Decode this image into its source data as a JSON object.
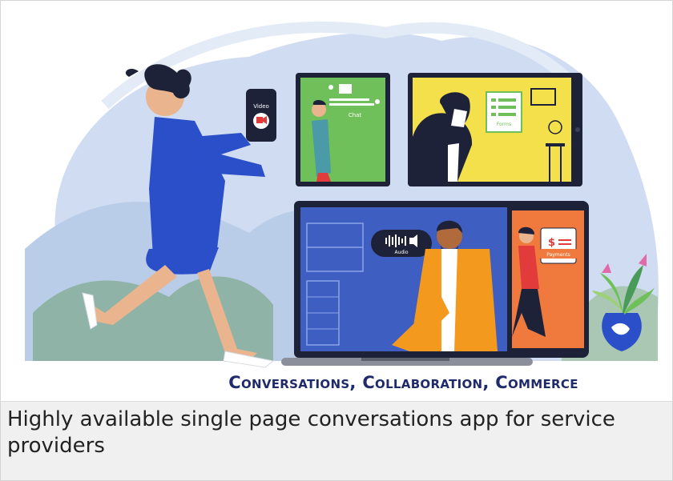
{
  "screens": {
    "video_label": "Video",
    "chat_label": "Chat",
    "forms_label": "Forms",
    "audio_label": "Audio",
    "payments_label": "Payments",
    "payments_amount_symbol": "$"
  },
  "hero": {
    "tagline": "Conversations, Collaboration, Commerce"
  },
  "card": {
    "description": "Highly available single page conversations app for service providers"
  },
  "colors": {
    "navy": "#1f2a6b",
    "green_screen": "#6fbf5a",
    "yellow_screen": "#f3e04a",
    "blue_screen": "#3f5ec2",
    "orange_screen": "#f07a3e",
    "sky": "#c9d7ee"
  }
}
